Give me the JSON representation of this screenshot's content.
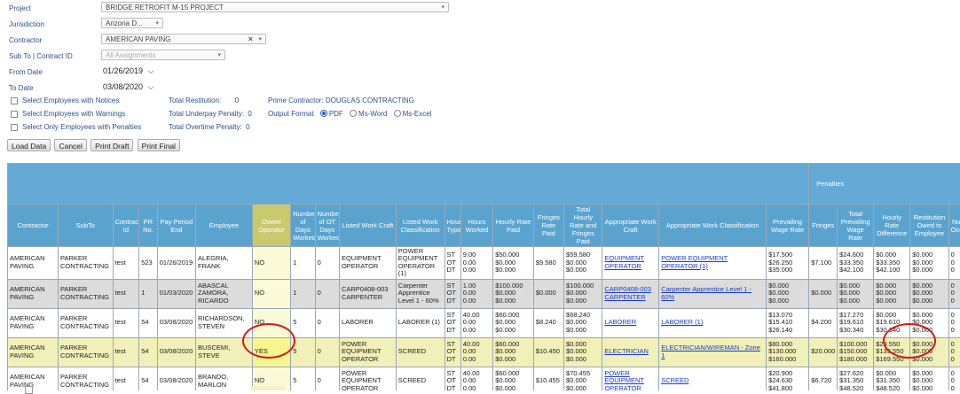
{
  "filters": {
    "project": {
      "label": "Project",
      "value": "BRIDGE RETROFIT M-15 PROJECT"
    },
    "jurisdiction": {
      "label": "Jurisdiction",
      "value": "Arizona D..."
    },
    "contractor": {
      "label": "Contractor",
      "value": "AMERICAN PAVING"
    },
    "subto": {
      "label": "Sub To | Contract ID",
      "value": "All Assignments"
    },
    "from_date": {
      "label": "From Date",
      "value": "01/26/2019"
    },
    "to_date": {
      "label": "To Date",
      "value": "03/08/2020"
    }
  },
  "options": {
    "notices": "Select Employees with Notices",
    "warnings": "Select Employees with Warnings",
    "penalties": "Select Only Employees with Penalties",
    "total_restitution": "Total Restitution:",
    "total_restitution_value": "0",
    "total_underpay": "Total Underpay Penalty:",
    "total_underpay_value": "0",
    "total_overtime": "Total Overtime Penalty:",
    "total_overtime_value": "0",
    "prime_contractor": "Prime Contractor: DOUGLAS CONTRACTING",
    "output_format": "Output Format",
    "fmt_pdf": "PDF",
    "fmt_word": "Ms-Word",
    "fmt_excel": "Ms-Excel"
  },
  "buttons": {
    "load": "Load Data",
    "cancel": "Cancel",
    "print_draft": "Print Draft",
    "print_final": "Print Final"
  },
  "grid": {
    "group_header": "Penalties",
    "columns": [
      "Contractor",
      "SubTo",
      "Contract Id",
      "PR No.",
      "Pay Period End",
      "Employee",
      "Owner Operator",
      "Number of Days Worked",
      "Number of OT Days Worked",
      "Listed Work Craft",
      "Listed Work Classification",
      "Hour Type",
      "Hours Worked",
      "Hourly Rate Paid",
      "Fringes Rate Paid",
      "Total Hourly Rate and Fringes Paid",
      "Appropriate Work Craft",
      "Appropriate Work Classification",
      "Prevailing Wage Rate",
      "Fringes",
      "Total Prevailing Wage Rate",
      "Hourly Rate Difference",
      "Restitution Owed to Employee",
      "Number Occurrences"
    ],
    "rows": [
      {
        "contractor": "AMERICAN PAVING",
        "subto": "PARKER CONTRACTING",
        "contract": "test",
        "pr": "523",
        "period": "01/26/2019",
        "employee": "ALEGRIA, FRANK",
        "owner": "NO",
        "days": "1",
        "ot_days": "0",
        "craft": "EQUIPMENT OPERATOR",
        "classification": "POWER EQUIPMENT OPERATOR (1)",
        "hour_type": [
          "ST",
          "OT",
          "DT"
        ],
        "hours": [
          "9.00",
          "0.00",
          "0.00"
        ],
        "rate": [
          "$50.000",
          "$0.000",
          "$0.000"
        ],
        "fringe_paid": "$9.580",
        "total_paid": [
          "$59.580",
          "$0.000",
          "$0.000"
        ],
        "app_craft": "EQUIPMENT OPERATOR",
        "app_class": "POWER EQUIPMENT OPERATOR (1)",
        "prev_rate": [
          "$17.500",
          "$26.250",
          "$35.000"
        ],
        "fringes": "$7.100",
        "total_prev": [
          "$24.600",
          "$33.350",
          "$42.100"
        ],
        "diff": [
          "$0.000",
          "$33.350",
          "$42.100"
        ],
        "restitution": [
          "$0.000",
          "$0.000",
          "$0.000"
        ],
        "occurrences": [
          "0",
          "0",
          "0"
        ]
      },
      {
        "contractor": "AMERICAN PAVING",
        "subto": "PARKER CONTRACTING",
        "contract": "test",
        "pr": "1",
        "period": "01/03/2020",
        "employee": "ABASCAL ZAMORA, RICARDO",
        "owner": "NO",
        "days": "1",
        "ot_days": "0",
        "craft": "CARP0408-003 CARPENTER",
        "classification": "Carpenter Apprentice Level 1 - 60%",
        "hour_type": [
          "ST",
          "OT",
          "DT"
        ],
        "hours": [
          "1.00",
          "0.00",
          "0.00"
        ],
        "rate": [
          "$100.000",
          "$0.000",
          "$0.000"
        ],
        "fringe_paid": "$0.000",
        "total_paid": [
          "$100.000",
          "$0.000",
          "$0.000"
        ],
        "app_craft": "CARP0408-003 CARPENTER",
        "app_class": "Carpenter Apprentice Level 1 - 60%",
        "prev_rate": [
          "$0.000",
          "$0.000",
          "$0.000"
        ],
        "fringes": "$0.000",
        "total_prev": [
          "$0.000",
          "$0.000",
          "$0.000"
        ],
        "diff": [
          "$0.000",
          "$0.000",
          "$0.000"
        ],
        "restitution": [
          "$0.000",
          "$0.000",
          "$0.000"
        ],
        "occurrences": [
          "0",
          "0",
          "0"
        ]
      },
      {
        "contractor": "AMERICAN PAVING",
        "subto": "PARKER CONTRACTING",
        "contract": "test",
        "pr": "54",
        "period": "03/08/2020",
        "employee": "RICHARDSON, STEVEN",
        "owner": "NO",
        "days": "5",
        "ot_days": "0",
        "craft": "LABORER",
        "classification": "LABORER (1)",
        "hour_type": [
          "ST",
          "OT",
          "DT"
        ],
        "hours": [
          "40.00",
          "0.00",
          "0.00"
        ],
        "rate": [
          "$60.000",
          "$0.000",
          "$0.000"
        ],
        "fringe_paid": "$8.240",
        "total_paid": [
          "$68.240",
          "$0.000",
          "$0.000"
        ],
        "app_craft": "LABORER",
        "app_class": "LABORER (1)",
        "prev_rate": [
          "$13.070",
          "$15.410",
          "$26.140"
        ],
        "fringes": "$4.200",
        "total_prev": [
          "$17.270",
          "$19.610",
          "$30.340"
        ],
        "diff": [
          "$0.000",
          "$19.610",
          "$30.340"
        ],
        "restitution": [
          "$0.000",
          "$0.000",
          "$0.000"
        ],
        "occurrences": [
          "0",
          "0",
          "0"
        ]
      },
      {
        "contractor": "AMERICAN PAVING",
        "subto": "PARKER CONTRACTING",
        "contract": "test",
        "pr": "54",
        "period": "03/08/2020",
        "employee": "BUSCEMI, STEVE",
        "owner": "YES",
        "days": "5",
        "ot_days": "0",
        "craft": "POWER EQUIPMENT OPERATOR",
        "classification": "SCREED",
        "hour_type": [
          "ST",
          "OT",
          "DT"
        ],
        "hours": [
          "40.00",
          "0.00",
          "0.00"
        ],
        "rate": [
          "$60.000",
          "$0.000",
          "$0.000"
        ],
        "fringe_paid": "$10.450",
        "total_paid": [
          "$0.000",
          "$0.000",
          "$0.000"
        ],
        "app_craft": "ELECTRICIAN",
        "app_class": "ELECTRICIAN/WIREMAN - Zone 1",
        "prev_rate": [
          "$80.000",
          "$130.000",
          "$160.000"
        ],
        "fringes": "$20.000",
        "total_prev": [
          "$100.000",
          "$150.000",
          "$180.000"
        ],
        "diff": [
          "$29.550",
          "$139.550",
          "$169.550"
        ],
        "restitution": [
          "$0.000",
          "$0.000",
          "$0.000"
        ],
        "occurrences": [
          "0",
          "0",
          "0"
        ]
      },
      {
        "contractor": "AMERICAN PAVING",
        "subto": "PARKER CONTRACTING",
        "contract": "test",
        "pr": "54",
        "period": "03/08/2020",
        "employee": "BRANDO, MARLON",
        "owner": "NO",
        "days": "5",
        "ot_days": "0",
        "craft": "POWER EQUIPMENT OPERATOR",
        "classification": "SCREED",
        "hour_type": [
          "ST",
          "OT",
          "DT"
        ],
        "hours": [
          "40.00",
          "0.00",
          "0.00"
        ],
        "rate": [
          "$60.000",
          "$0.000",
          "$0.000"
        ],
        "fringe_paid": "$10.455",
        "total_paid": [
          "$70.455",
          "$0.000",
          "$0.000"
        ],
        "app_craft": "POWER EQUIPMENT OPERATOR",
        "app_class": "SCREED",
        "prev_rate": [
          "$20.900",
          "$24.630",
          "$41.800"
        ],
        "fringes": "$6.720",
        "total_prev": [
          "$27.620",
          "$31.350",
          "$48.520"
        ],
        "diff": [
          "$0.000",
          "$31.350",
          "$48.520"
        ],
        "restitution": [
          "$0.000",
          "$0.000",
          "$0.000"
        ],
        "occurrences": [
          "0",
          "0",
          "0"
        ]
      }
    ]
  },
  "colors": {
    "header_blue": "#5ba3cf",
    "owner_header": "#c9c970",
    "highlight_row": "#f0f0b8",
    "annotation_red": "#d41818",
    "link_blue": "#1a3ad0"
  }
}
